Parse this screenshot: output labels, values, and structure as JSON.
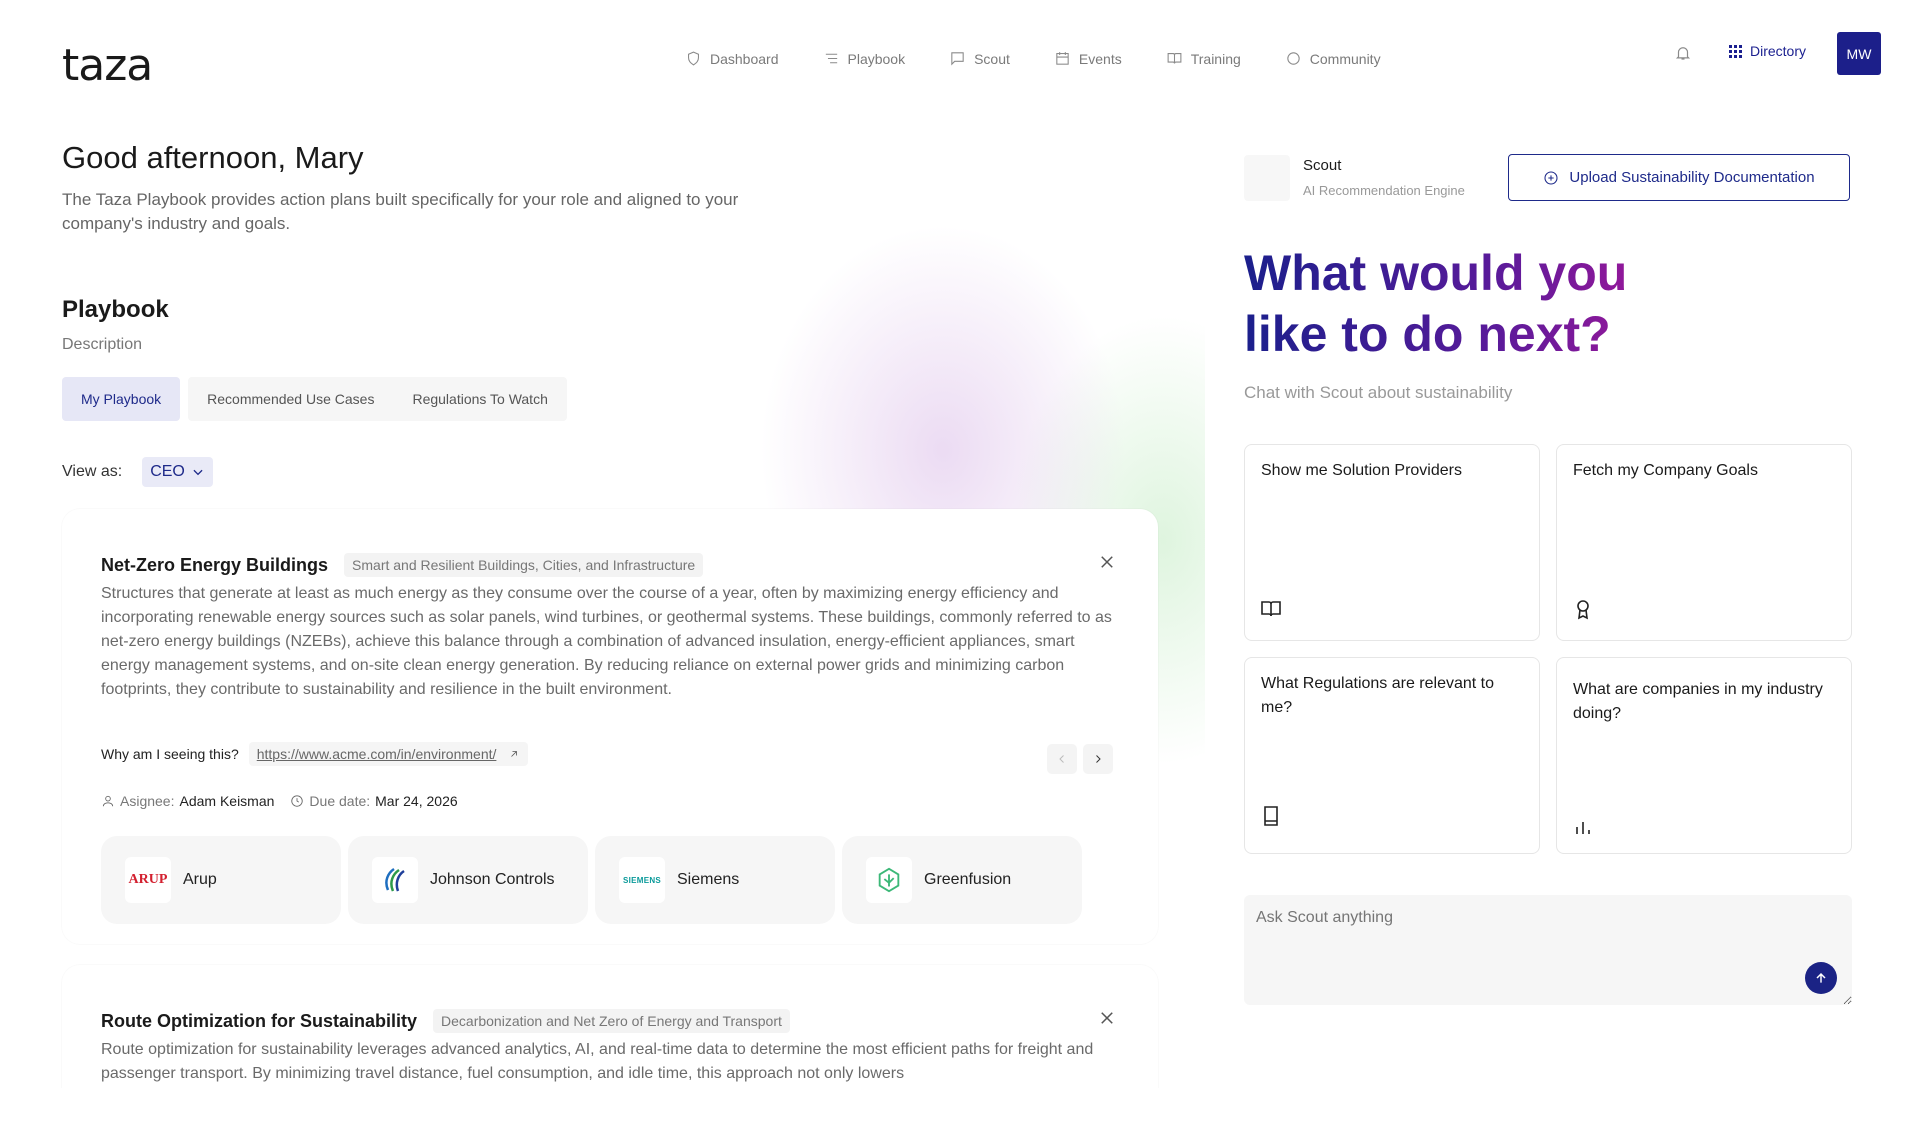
{
  "brand": {
    "logo": "taza"
  },
  "nav": {
    "items": [
      {
        "label": "Dashboard",
        "icon": "shield-icon"
      },
      {
        "label": "Playbook",
        "icon": "list-icon"
      },
      {
        "label": "Scout",
        "icon": "chat-icon"
      },
      {
        "label": "Events",
        "icon": "calendar-icon"
      },
      {
        "label": "Training",
        "icon": "book-icon"
      },
      {
        "label": "Community",
        "icon": "globe-icon"
      }
    ],
    "directory_label": "Directory",
    "avatar_initials": "MW"
  },
  "main": {
    "greeting": "Good afternoon, Mary",
    "intro": "The Taza Playbook provides action plans built specifically for your role and aligned to your company's industry and goals.",
    "section_title": "Playbook",
    "section_desc": "Description",
    "tabs": [
      {
        "label": "My Playbook",
        "active": true
      },
      {
        "label": "Recommended Use Cases",
        "active": false
      },
      {
        "label": "Regulations To Watch",
        "active": false
      }
    ],
    "view_as_label": "View as:",
    "view_as_value": "CEO"
  },
  "cards": [
    {
      "title": "Net-Zero Energy Buildings",
      "category": "Smart and Resilient Buildings, Cities, and Infrastructure",
      "body": "Structures that generate at least as much energy as they consume over the course of a year, often by maximizing energy efficiency and incorporating renewable energy sources such as solar panels, wind turbines, or geothermal systems. These buildings, commonly referred to as net-zero energy buildings (NZEBs), achieve this balance through a combination of advanced insulation, energy-efficient appliances, smart energy management systems, and on-site clean energy generation. By reducing reliance on external power grids and minimizing carbon footprints, they contribute to sustainability and resilience in the built environment.",
      "why_label": "Why am I seeing this?",
      "why_link": "https://www.acme.com/in/environment/",
      "assignee_label": "Asignee:",
      "assignee": "Adam Keisman",
      "due_label": "Due date:",
      "due": "Mar 24, 2026",
      "providers": [
        {
          "name": "Arup",
          "logo_text": "ARUP"
        },
        {
          "name": "Johnson Controls",
          "logo_text": ""
        },
        {
          "name": "Siemens",
          "logo_text": "SIEMENS"
        },
        {
          "name": "Greenfusion",
          "logo_text": ""
        }
      ]
    },
    {
      "title": "Route Optimization for Sustainability",
      "category": "Decarbonization and Net Zero of Energy and Transport",
      "body": "Route optimization for sustainability leverages advanced analytics, AI, and real-time data to determine the most efficient paths for freight and passenger transport. By minimizing travel distance, fuel consumption, and idle time, this approach not only lowers"
    }
  ],
  "scout": {
    "name": "Scout",
    "subtitle": "AI Recommendation Engine",
    "upload_label": "Upload Sustainability Documentation",
    "headline_line1": "What would you",
    "headline_line2": "like to do next?",
    "chat_sub": "Chat with Scout about sustainability",
    "suggestions": [
      {
        "label": "Show me Solution Providers",
        "icon": "book-open-icon"
      },
      {
        "label": "Fetch my Company Goals",
        "icon": "award-icon"
      },
      {
        "label": "What Regulations are relevant to me?",
        "icon": "book-icon"
      },
      {
        "label": "What are companies in my industry doing?",
        "icon": "bar-chart-icon"
      }
    ],
    "ask_placeholder": "Ask Scout anything"
  },
  "colors": {
    "brand": "#1c1f8a",
    "accent_purple": "#a0189a"
  }
}
